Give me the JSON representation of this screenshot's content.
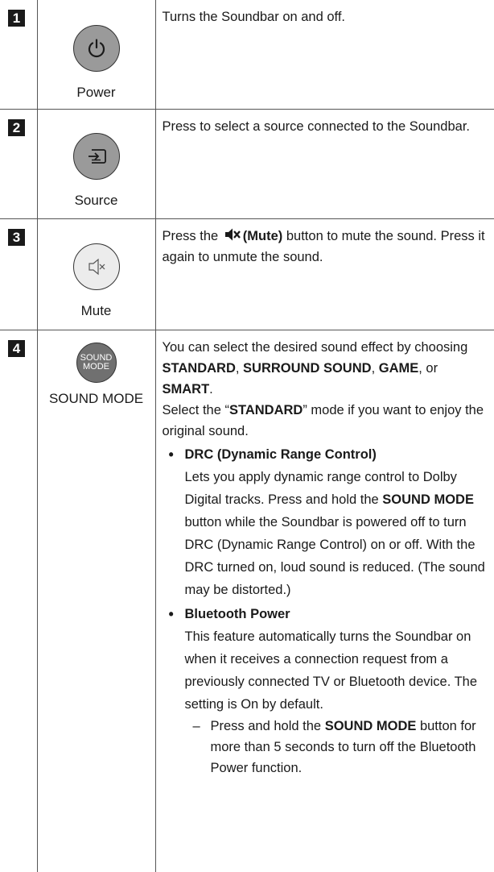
{
  "rows": [
    {
      "num": "1",
      "icon": "power-icon",
      "label": "Power",
      "desc": "Turns the Soundbar on and off."
    },
    {
      "num": "2",
      "icon": "source-icon",
      "label": "Source",
      "desc": "Press to select a source connected to the Soundbar."
    },
    {
      "num": "3",
      "icon": "mute-icon",
      "label": "Mute",
      "desc_pre": "Press the",
      "desc_bold": "(Mute)",
      "desc_post": "button to mute the sound. Press it again to unmute the sound."
    },
    {
      "num": "4",
      "icon": "sound-mode-button",
      "button_text_line1": "SOUND",
      "button_text_line2": "MODE",
      "label": "SOUND MODE",
      "intro_pre": "You can select the desired sound effect by choosing",
      "mode1": "STANDARD",
      "sep1": ",",
      "mode2": "SURROUND SOUND",
      "sep2": ",",
      "mode3": "GAME",
      "sep3": ", or",
      "mode4": "SMART",
      "intro_end": ".",
      "select_pre": "Select the “",
      "select_bold": "STANDARD",
      "select_post": "” mode if you want to enjoy the original sound.",
      "bullet1_title": "DRC (Dynamic Range Control)",
      "bullet1_pre": "Lets you apply dynamic range control to Dolby Digital tracks. Press and hold the",
      "bullet1_bold": "SOUND MODE",
      "bullet1_post": "button while the Soundbar is powered off to turn DRC (Dynamic Range Control) on or off. With the DRC turned on, loud sound is reduced. (The sound may be distorted.)",
      "bullet2_title": "Bluetooth Power",
      "bullet2_body": "This feature automatically turns the Soundbar on when it receives a connection request from a previously connected TV or Bluetooth device. The setting is On by default.",
      "dash_mark": "–",
      "dash_pre": "Press and hold the",
      "dash_bold": "SOUND MODE",
      "dash_post": "button for more than 5 seconds to turn off the Bluetooth Power function."
    }
  ]
}
